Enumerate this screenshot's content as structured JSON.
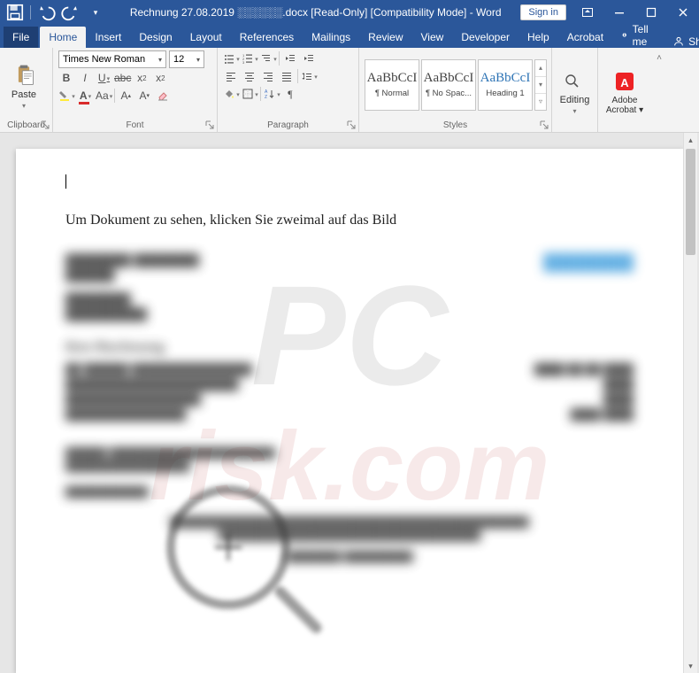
{
  "titlebar": {
    "doc_title": "Rechnung 27.08.2019 ░░░░░░.docx [Read-Only] [Compatibility Mode] - Word",
    "signin": "Sign in"
  },
  "tabs": {
    "file": "File",
    "home": "Home",
    "insert": "Insert",
    "design": "Design",
    "layout": "Layout",
    "references": "References",
    "mailings": "Mailings",
    "review": "Review",
    "view": "View",
    "developer": "Developer",
    "help": "Help",
    "acrobat": "Acrobat",
    "tellme": "Tell me",
    "share": "Share"
  },
  "ribbon": {
    "clipboard": {
      "label": "Clipboard",
      "paste": "Paste"
    },
    "font": {
      "label": "Font",
      "family": "Times New Roman",
      "size": "12"
    },
    "paragraph": {
      "label": "Paragraph"
    },
    "styles": {
      "label": "Styles",
      "preview": "AaBbCcI",
      "items": [
        "¶ Normal",
        "¶ No Spac...",
        "Heading 1"
      ]
    },
    "editing": {
      "label": "Editing"
    },
    "acrobat": {
      "label": "Adobe Acrobat ▾"
    }
  },
  "document": {
    "instruction": "Um Dokument zu sehen, klicken Sie zweimal auf das Bild",
    "blurry": {
      "addr1": "████████ ████████",
      "addr2": "██████",
      "addr3": "████████",
      "addr4": "██████████",
      "brand_a": "████",
      "brand_b": "████",
      "heading": "Ihre Rechnung",
      "line1_l": "██  ██████ ████████████████",
      "line1_r": "████    ██    ██    ████",
      "line2_l": "███████████████████████",
      "line2_r": "████",
      "line3_l": "██████████████████",
      "line3_r": "████",
      "line4_l": "████████████████",
      "line4_r": "████    ████",
      "foot1": "██████ ████████████████████████",
      "foot2": "██████████████████",
      "foot3": "████████████",
      "foot4": "████████████████████████████████████████████████████",
      "foot5": "██████████████████████████████████████",
      "foot6": "████████  ██████████"
    }
  },
  "watermark": {
    "line1": "PC",
    "line2": "risk.com"
  }
}
